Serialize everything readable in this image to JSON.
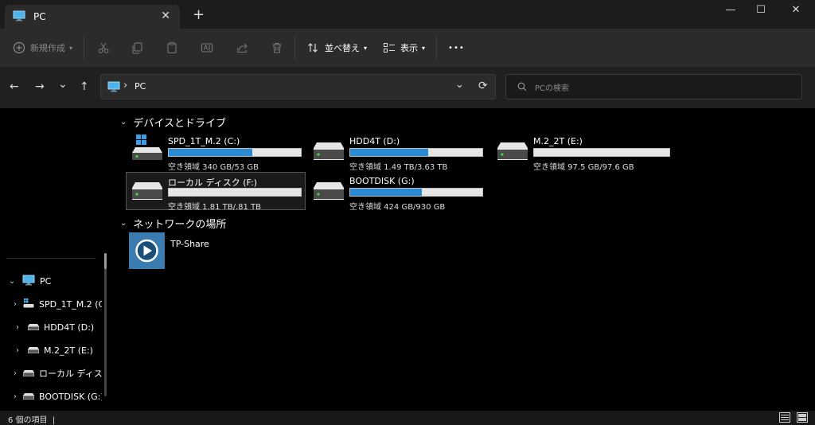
{
  "tab": {
    "title": "PC",
    "close": "✕",
    "new_tab": "+"
  },
  "window": {
    "minimize": "—",
    "maximize": "☐",
    "close": "✕"
  },
  "toolbar": {
    "new_label": "新規作成",
    "sort_label": "並べ替え",
    "view_label": "表示",
    "more_label": "•••"
  },
  "nav": {
    "back": "←",
    "forward": "→",
    "recent": "⌄",
    "up": "↑"
  },
  "address": {
    "separator": "›",
    "path": "PC",
    "dropdown": "⌄",
    "refresh": "⟳"
  },
  "search": {
    "placeholder": "PCの検索"
  },
  "sidebar": {
    "pc": {
      "label": "PC"
    },
    "items": [
      {
        "label": "SPD_1T_M.2 (C"
      },
      {
        "label": "HDD4T (D:)"
      },
      {
        "label": "M.2_2T (E:)"
      },
      {
        "label": "ローカル ディスク"
      },
      {
        "label": "BOOTDISK (G:)"
      }
    ]
  },
  "groups": {
    "devices": "デバイスとドライブ",
    "network": "ネットワークの場所"
  },
  "drives": [
    {
      "name": "SPD_1T_M.2 (C:)",
      "free": "空き領域 340 GB/53 GB",
      "used_fraction": 0.63,
      "icon": "windows-drive-icon"
    },
    {
      "name": "HDD4T (D:)",
      "free": "空き領域 1.49 TB/3.63 TB",
      "used_fraction": 0.59,
      "icon": "drive-icon"
    },
    {
      "name": "M.2_2T (E:)",
      "free": "空き領域 97.5 GB/97.6 GB",
      "used_fraction": 0.0,
      "icon": "drive-icon"
    },
    {
      "name": "ローカル ディスク (F:)",
      "free": "空き領域 1.81 TB/.81 TB",
      "used_fraction": 0.0,
      "icon": "drive-icon"
    },
    {
      "name": "BOOTDISK (G:)",
      "free": "空き領域 424 GB/930 GB",
      "used_fraction": 0.54,
      "icon": "drive-icon"
    }
  ],
  "network": [
    {
      "name": "TP-Share",
      "icon": "media-server-icon"
    }
  ],
  "status": {
    "count": "6 個の項目",
    "cursor": "|"
  },
  "colors": {
    "accent": "#2a8ad4",
    "toolbar": "#2b2b2b",
    "tab": "#2b2b2b"
  }
}
